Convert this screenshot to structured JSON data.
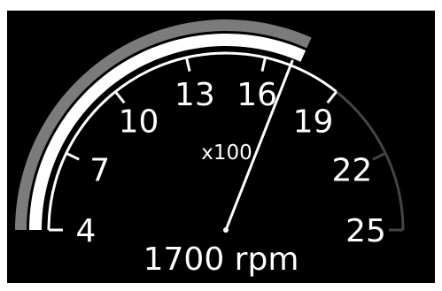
{
  "gauge": {
    "title": "",
    "scale_min": 4,
    "scale_max": 25,
    "tick_labels": [
      "4",
      "7",
      "10",
      "13",
      "16",
      "19",
      "22",
      "25"
    ],
    "tick_values": [
      4,
      7,
      10,
      13,
      16,
      19,
      22,
      25
    ],
    "unit_multiplier": "x100",
    "current_value": 17,
    "readout": "1700 rpm",
    "progress_fraction": 0.633,
    "colors": {
      "background": "#000000",
      "scale": "#ffffff",
      "scale_dim": "#444444",
      "outer_band": "#7b7b7b",
      "progress_band": "#ffffff",
      "needle": "#ffffff"
    }
  }
}
